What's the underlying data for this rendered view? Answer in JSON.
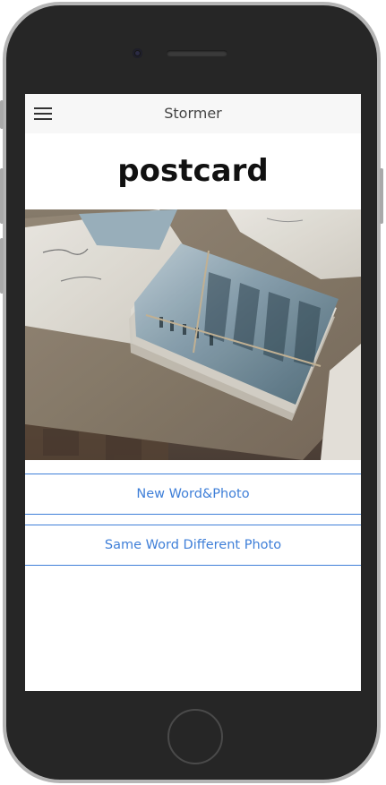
{
  "header": {
    "title": "Stormer",
    "menu_icon": "hamburger-menu-icon"
  },
  "main": {
    "word": "postcard",
    "photo_subject": "",
    "buttons": {
      "new_word_photo": "New Word&Photo",
      "same_word_different_photo": "Same Word Different Photo"
    }
  },
  "colors": {
    "accent": "#3f7fd8",
    "header_bg": "#f7f7f7",
    "device_frame": "#262626"
  }
}
